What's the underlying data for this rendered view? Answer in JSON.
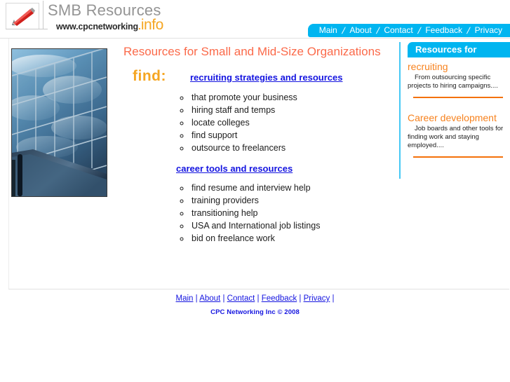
{
  "header": {
    "logo_icon": "pencil-icon",
    "wordmark_main": "SMB Resources",
    "wordmark_url": "www.cpcnetworking",
    "wordmark_dot": ".",
    "wordmark_tld": "info"
  },
  "nav": {
    "separator": "/",
    "items": [
      {
        "label": "Main"
      },
      {
        "label": "About"
      },
      {
        "label": "Contact"
      },
      {
        "label": "Feedback"
      },
      {
        "label": "Privacy"
      }
    ]
  },
  "main": {
    "photo_alt": "glass-office-building-photo",
    "page_title": "Resources for Small and Mid-Size Organizations",
    "find_label": "find:",
    "sections": [
      {
        "link": "recruiting strategies and resources",
        "items": [
          "that promote your business",
          "hiring staff and temps",
          "locate colleges",
          "find support",
          "outsource to freelancers"
        ]
      },
      {
        "link": "career tools and resources",
        "items": [
          "find resume and interview help",
          "training providers",
          "transitioning help",
          "USA and International job listings",
          "bid on freelance work"
        ]
      }
    ]
  },
  "sidebar": {
    "title": "Resources for",
    "sections": [
      {
        "heading": "recruiting",
        "body": "From outsourcing specific projects to hiring campaigns...."
      },
      {
        "heading": "Career development",
        "body": "Job boards and other tools for finding work and staying employed...."
      }
    ]
  },
  "footer": {
    "separator": "|",
    "links": [
      {
        "label": "Main"
      },
      {
        "label": "About"
      },
      {
        "label": "Contact"
      },
      {
        "label": "Feedback"
      },
      {
        "label": "Privacy"
      }
    ],
    "copyright": "CPC Networking Inc © 2008"
  },
  "colors": {
    "cyan": "#00b5f0",
    "orange": "#f7821e",
    "amber": "#f5a623",
    "coral": "#fb6a4a",
    "link_blue": "#1414e0",
    "rule_orange": "#f4710a"
  }
}
